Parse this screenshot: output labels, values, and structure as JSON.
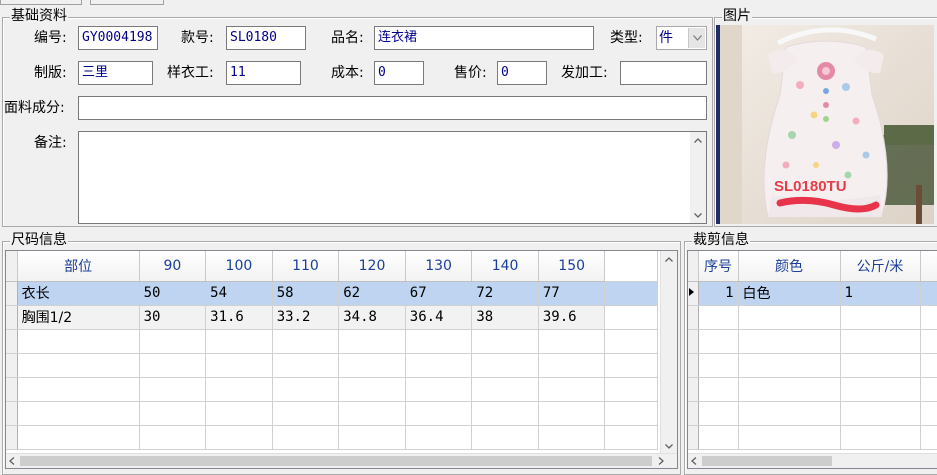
{
  "basic": {
    "title": "基础资料",
    "code_label": "编号:",
    "code_value": "GY0004198",
    "style_label": "款号:",
    "style_value": "SL0180",
    "name_label": "品名:",
    "name_value": "连衣裙",
    "type_label": "类型:",
    "type_value": "件",
    "pattern_label": "制版:",
    "pattern_value": "三里",
    "sample_label": "样衣工:",
    "sample_value": "11",
    "cost_label": "成本:",
    "cost_value": "0",
    "price_label": "售价:",
    "price_value": "0",
    "outsource_label": "发加工:",
    "outsource_value": "",
    "fabric_label": "面料成分:",
    "fabric_value": "",
    "remark_label": "备注:",
    "remark_value": ""
  },
  "picture": {
    "title": "图片",
    "product_text": "SL0180TU"
  },
  "size_info": {
    "title": "尺码信息",
    "columns": [
      "部位",
      "90",
      "100",
      "110",
      "120",
      "130",
      "140",
      "150"
    ],
    "rows": [
      [
        "衣长",
        "50",
        "54",
        "58",
        "62",
        "67",
        "72",
        "77"
      ],
      [
        "胸围1/2",
        "30",
        "31.6",
        "33.2",
        "34.8",
        "36.4",
        "38",
        "39.6"
      ]
    ]
  },
  "cut_info": {
    "title": "裁剪信息",
    "columns": [
      "序号",
      "颜色",
      "公斤/米"
    ],
    "rows": [
      [
        "1",
        "白色",
        "1"
      ]
    ]
  },
  "colors": {
    "selection": "#bed4f0",
    "header_text": "#1b3f9a",
    "field_text": "#00008b"
  }
}
